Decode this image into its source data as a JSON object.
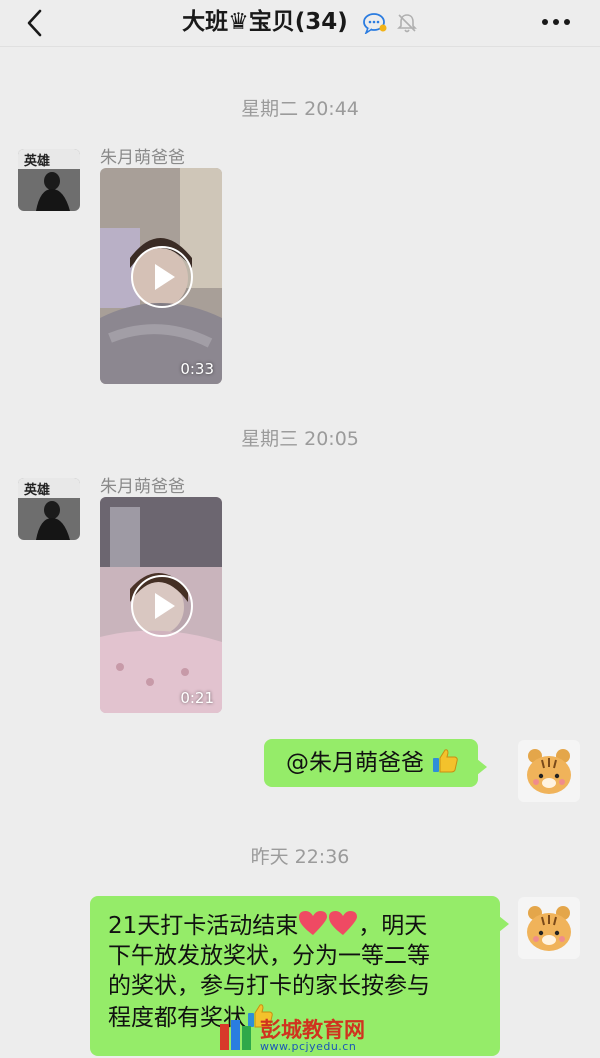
{
  "header": {
    "title": "大班♛宝贝",
    "member_count": "(34)",
    "icons": [
      "back-chevron-icon",
      "group-chat-icon",
      "mute-bell-icon",
      "more-dots-icon"
    ]
  },
  "messages": [
    {
      "type": "timestamp",
      "text": "星期二 20:44"
    },
    {
      "type": "video",
      "sender": "朱月萌爸爸",
      "duration": "0:33"
    },
    {
      "type": "timestamp",
      "text": "星期三 20:05"
    },
    {
      "type": "video",
      "sender": "朱月萌爸爸",
      "duration": "0:21"
    },
    {
      "type": "text",
      "from": "me",
      "text": "@朱月萌爸爸 ",
      "emoji": "thumbs-up-icon"
    },
    {
      "type": "timestamp",
      "text": "昨天 22:36"
    },
    {
      "type": "text",
      "from": "me",
      "lines": [
        "21天打卡活动结束",
        "，明天",
        "下午放发放奖状，分为一等二等",
        "的奖状，参与打卡的家长按参与",
        "程度都有奖状"
      ],
      "emoji": [
        "heart-icon",
        "heart-icon",
        "thumbs-up-icon"
      ]
    }
  ],
  "watermark": {
    "name": "彭城教育网",
    "url": "www.pcjyedu.cn"
  },
  "colors": {
    "bubble_green": "#95ec69",
    "background": "#ededed"
  }
}
